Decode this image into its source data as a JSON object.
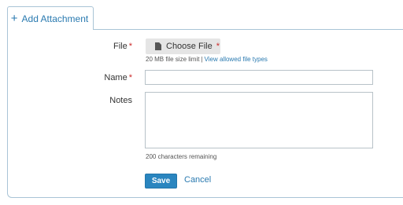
{
  "tab": {
    "plus": "+",
    "label": "Add Attachment"
  },
  "form": {
    "file": {
      "label": "File",
      "required_mark": "*",
      "button_label": "Choose File",
      "button_required_mark": "*",
      "size_hint": "20 MB file size limit",
      "separator": "|",
      "types_link": "View allowed file types"
    },
    "name": {
      "label": "Name",
      "required_mark": "*",
      "value": ""
    },
    "notes": {
      "label": "Notes",
      "value": "",
      "remaining": "200 characters remaining"
    },
    "save_label": "Save",
    "cancel_label": "Cancel"
  },
  "icons": {
    "file": "file-icon"
  },
  "colors": {
    "accent": "#2a7ab0",
    "save_bg": "#2a85bf",
    "required": "#cc2a2a",
    "border": "#a9c4d6"
  }
}
